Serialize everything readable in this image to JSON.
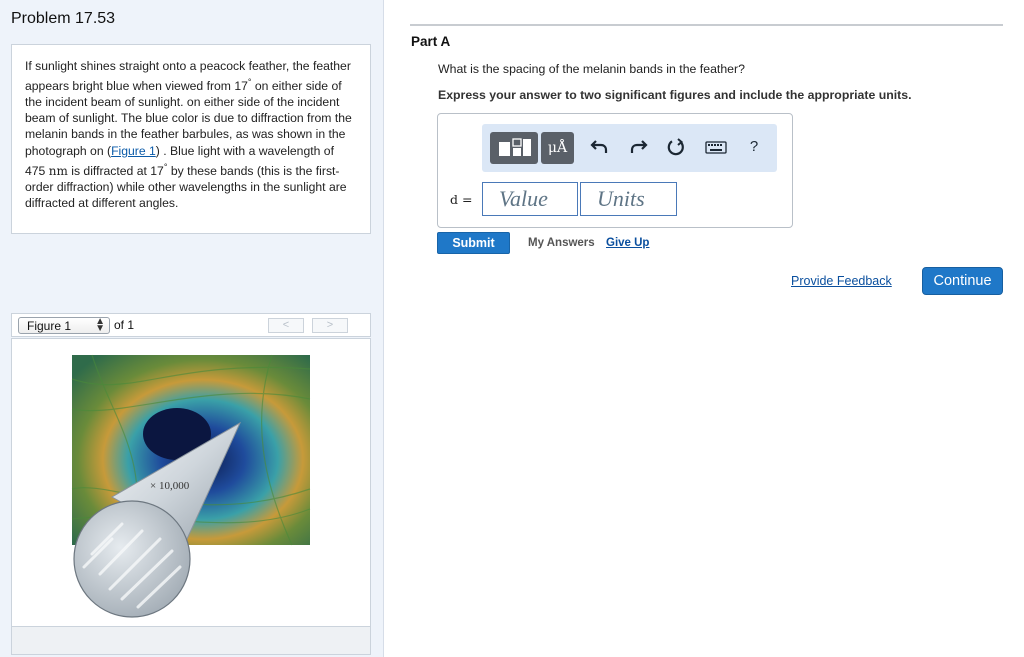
{
  "problem": {
    "title": "Problem 17.53",
    "text_1": "If sunlight shines straight onto a peacock feather, the feather appears bright blue when viewed from 17",
    "degree": "°",
    "text_2": " on either side of the incident beam of sunlight. on either side of the incident beam of sunlight. The blue color is due to diffraction from the melanin bands in the feather barbules, as was shown in the photograph on (",
    "figure_link": "Figure 1",
    "text_3": ") . Blue light with a wavelength of 475 ",
    "unit_nm": "nm",
    "text_4": " is diffracted at 17",
    "text_5": " by these bands (this is the first-order diffraction) while other wavelengths in the sunlight are diffracted at different angles."
  },
  "figure": {
    "selector_label": "Figure 1",
    "of_label": "of 1",
    "prev_label": "<",
    "next_label": ">",
    "magnification_label": "× 10,000"
  },
  "part": {
    "title": "Part A",
    "question": "What is the spacing of the melanin bands in the feather?",
    "instruction": "Express your answer to two significant figures and include the appropriate units."
  },
  "toolbar": {
    "units_label": "μÅ",
    "undo_icon": "undo-icon",
    "redo_icon": "redo-icon",
    "reset_icon": "reset-icon",
    "keyboard_icon": "keyboard-icon",
    "help_label": "?"
  },
  "answer": {
    "variable_label": "d =",
    "value_placeholder": "Value",
    "units_placeholder": "Units"
  },
  "actions": {
    "submit_label": "Submit",
    "my_answers_label": "My Answers",
    "give_up_label": "Give Up",
    "feedback_label": "Provide Feedback",
    "continue_label": "Continue"
  },
  "colors": {
    "accent_blue": "#1f78c8",
    "left_panel_bg": "#eef3fa",
    "toolbar_bg": "#dbe7f6",
    "link_blue": "#0a4f9e"
  }
}
